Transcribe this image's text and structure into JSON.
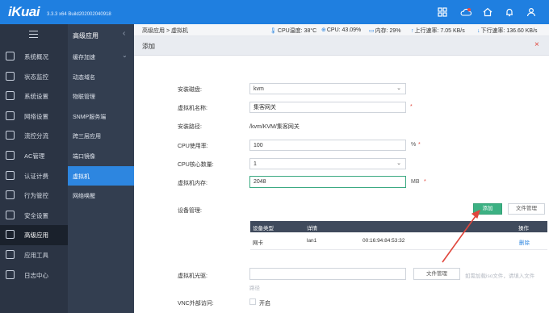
{
  "app": {
    "logo": "iKuai",
    "version": "3.3.3 x64 Build202002040918"
  },
  "topbar_icons": [
    "grid-icon",
    "cloud-icon",
    "home-icon",
    "bell-icon",
    "user-icon"
  ],
  "sidebar": {
    "items": [
      {
        "label": "系统概况",
        "icon": "gauge-icon"
      },
      {
        "label": "状态监控",
        "icon": "monitor-icon"
      },
      {
        "label": "系统设置",
        "icon": "gear-icon"
      },
      {
        "label": "网络设置",
        "icon": "network-icon"
      },
      {
        "label": "流控分流",
        "icon": "flow-icon"
      },
      {
        "label": "AC管理",
        "icon": "ac-icon"
      },
      {
        "label": "认证计费",
        "icon": "auth-icon"
      },
      {
        "label": "行为管控",
        "icon": "behavior-icon"
      },
      {
        "label": "安全设置",
        "icon": "shield-icon"
      },
      {
        "label": "高级应用",
        "icon": "advanced-icon"
      },
      {
        "label": "应用工具",
        "icon": "tools-icon"
      },
      {
        "label": "日志中心",
        "icon": "log-icon"
      }
    ]
  },
  "subnav": {
    "title": "高级应用",
    "items": [
      {
        "label": "缓存加速"
      },
      {
        "label": "动态域名"
      },
      {
        "label": "物联管理"
      },
      {
        "label": "SNMP服务端"
      },
      {
        "label": "跨三层应用"
      },
      {
        "label": "端口镜像"
      },
      {
        "label": "虚拟机"
      },
      {
        "label": "网络唤醒"
      }
    ]
  },
  "breadcrumb": "高级应用 > 虚拟机",
  "status": {
    "cpu_temp": "CPU温度: 38°C",
    "cpu": "CPU: 43.09%",
    "mem": "内存: 29%",
    "up": "上行速率: 7.05 KB/s",
    "down": "下行速率: 136.60 KB/s"
  },
  "dialog": {
    "title": "添加",
    "close": "×"
  },
  "form": {
    "disk_label": "安装磁盘:",
    "disk_value": "kvm",
    "name_label": "虚拟机名称:",
    "name_value": "集客网关",
    "path_label": "安装路径:",
    "path_value": "/kvm/KVM/集客网关",
    "cpu_usage_label": "CPU使用率:",
    "cpu_usage_value": "100",
    "cpu_usage_unit": "%",
    "cpu_cores_label": "CPU核心数量:",
    "cpu_cores_value": "1",
    "memory_label": "虚拟机内存:",
    "memory_value": "2048",
    "memory_unit": "MB",
    "required_mark": "*",
    "device_label": "设备管理:",
    "add_button": "添加",
    "file_manage_button": "文件管理",
    "cdrom_label": "虚拟机光驱:",
    "cdrom_file_button": "文件管理",
    "cdrom_hint": "如需加载iso文件，请填入文件",
    "cdrom_hint2": "路径",
    "vnc_label": "VNC外部访问:",
    "vnc_option": "开启"
  },
  "device_table": {
    "headers": [
      "设备类型",
      "详情",
      "操作"
    ],
    "rows": [
      {
        "type": "网卡",
        "name": "lan1",
        "mac": "00:16:94:84:53:32",
        "action": "删除"
      }
    ]
  },
  "colors": {
    "topbar": "#1f7fe0",
    "sidebar": "#2b3444",
    "active_sub": "#2d86e0",
    "add_button": "#3cb183",
    "arrow": "#e0463c"
  }
}
